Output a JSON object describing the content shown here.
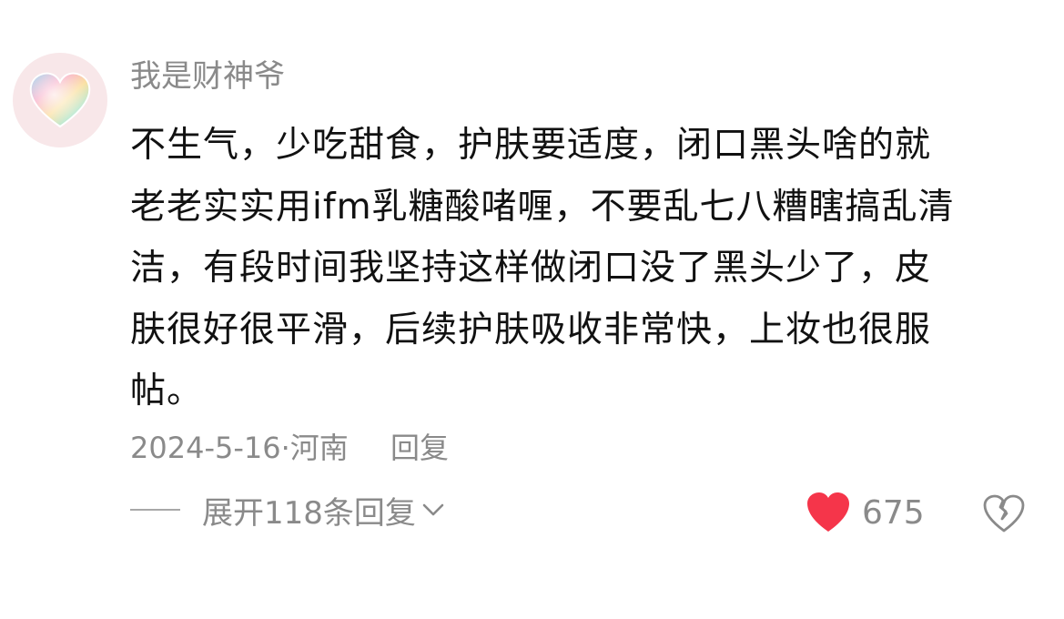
{
  "comment": {
    "username": "我是财神爷",
    "text_lines": [
      "不生气，少吃甜食，护肤要适度，闭口黑头啥的就",
      "老老实实用ifm乳糖酸啫喱，不要乱七八糟瞎搞乱清",
      "洁，有段时间我坚持这样做闭口没了黑头少了，皮",
      "肤很好很平滑，后续护肤吸收非常快，上妆也很服",
      "帖。"
    ],
    "date": "2024-5-16",
    "separator": "·",
    "location": "河南",
    "reply_label": "回复",
    "expand_label": "展开118条回复",
    "like_count": "675",
    "liked": true
  },
  "icons": {
    "avatar": "rainbow-heart-avatar",
    "like": "heart-icon",
    "dislike": "broken-heart-icon",
    "expand": "chevron-down-icon"
  },
  "colors": {
    "like_active": "#f5354a",
    "secondary_text": "#8a8a8a",
    "primary_text": "#111111"
  }
}
